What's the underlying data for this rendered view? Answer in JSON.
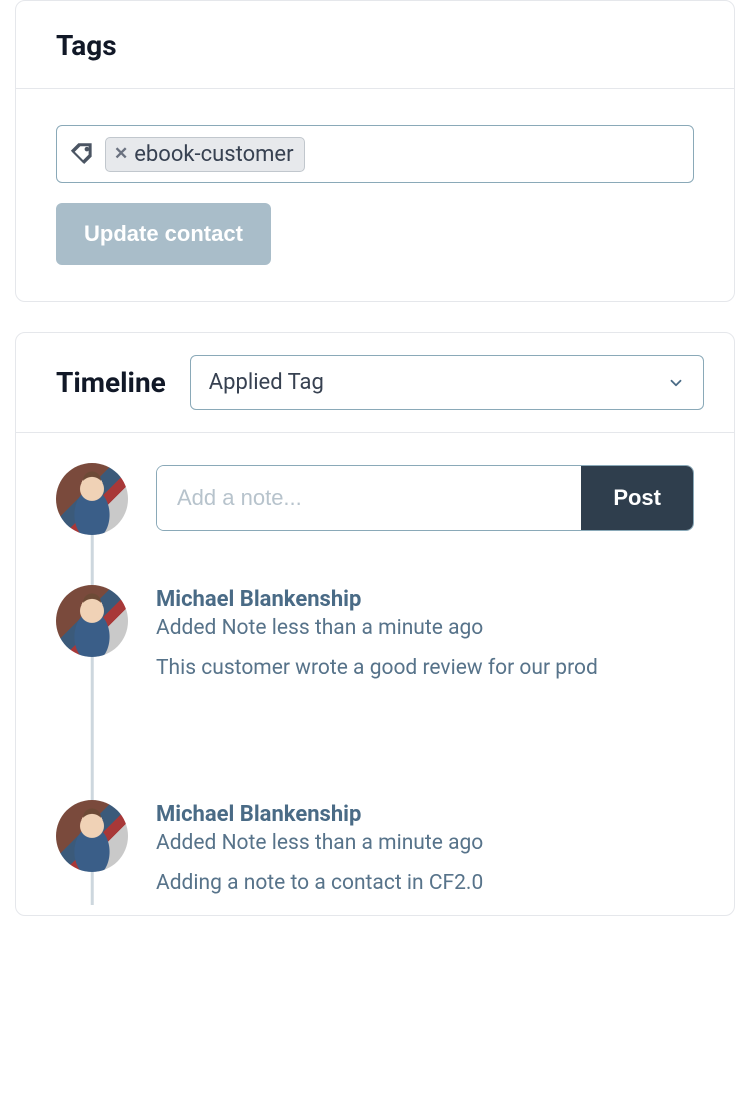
{
  "tags_card": {
    "title": "Tags",
    "tag_value": "ebook-customer",
    "update_button": "Update contact"
  },
  "timeline_card": {
    "title": "Timeline",
    "filter_selected": "Applied Tag",
    "note_placeholder": "Add a note...",
    "post_button": "Post",
    "entries": [
      {
        "author": "Michael Blankenship",
        "meta": "Added Note less than a minute ago",
        "text": "This customer wrote a good review for our prod"
      },
      {
        "author": "Michael Blankenship",
        "meta": "Added Note less than a minute ago",
        "text": "Adding a note to a contact in CF2.0"
      }
    ]
  }
}
